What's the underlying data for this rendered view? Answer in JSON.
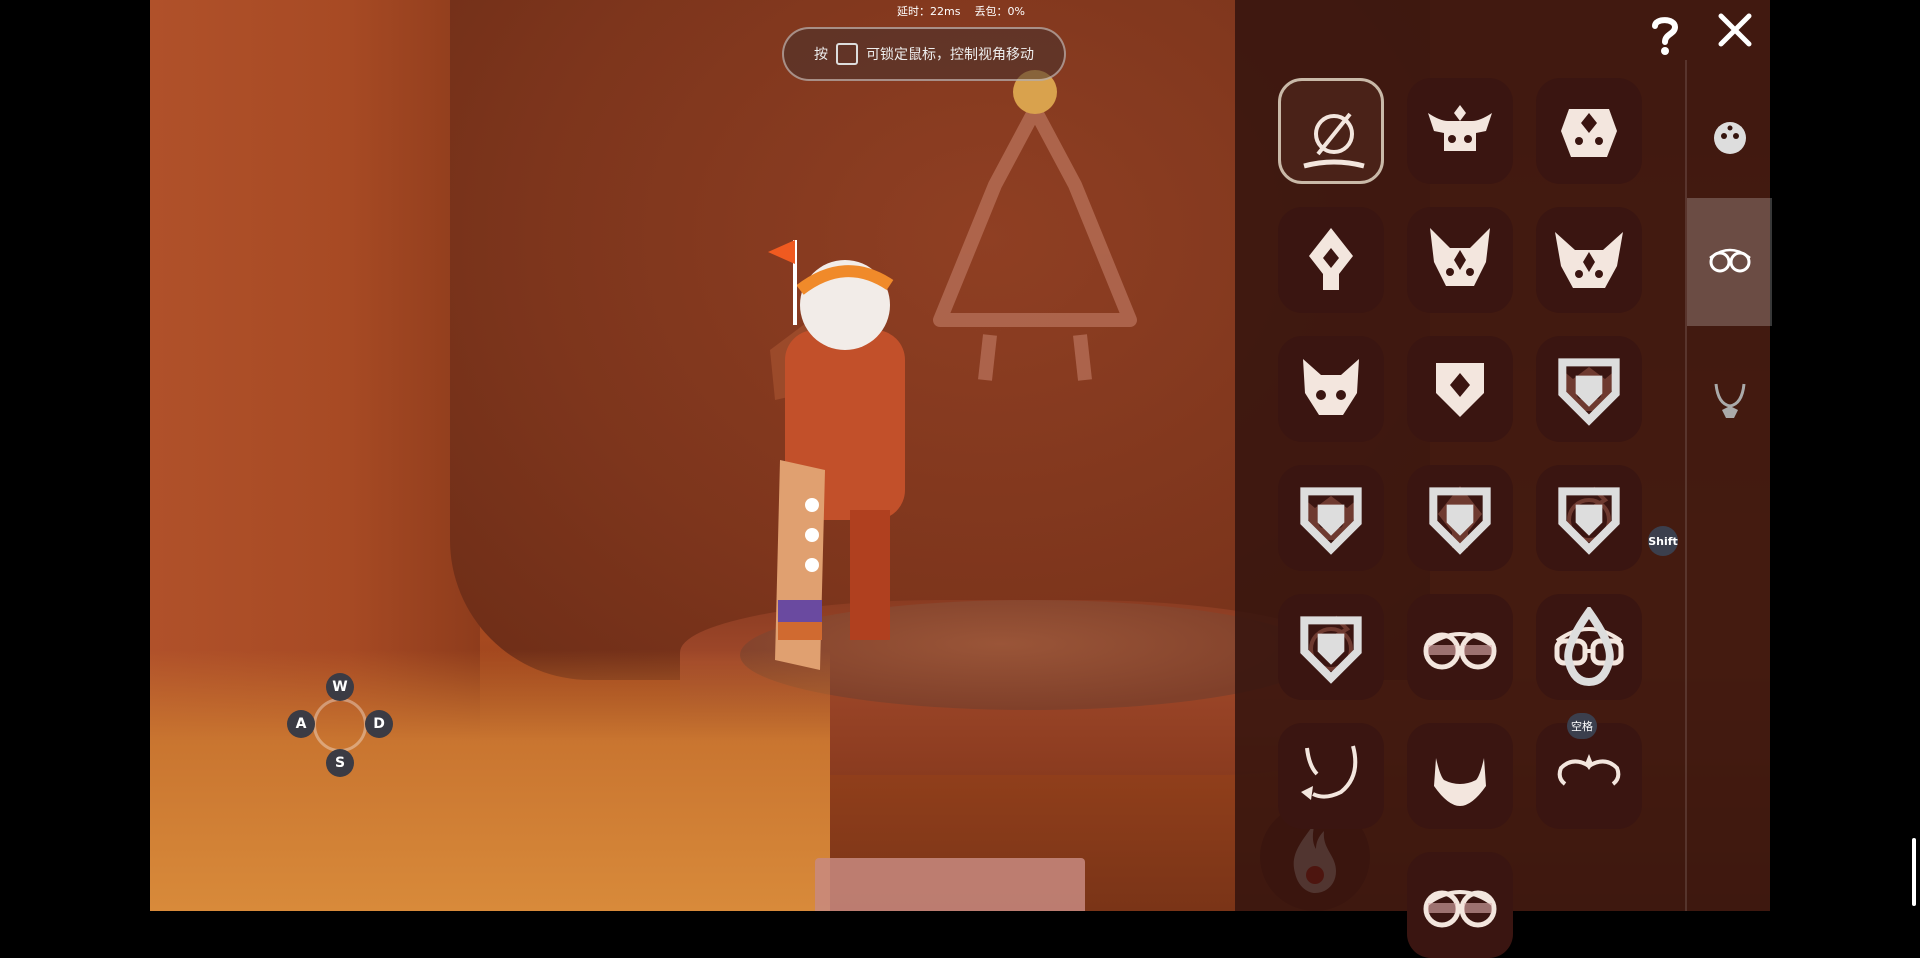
{
  "hud": {
    "latency": "延时：22ms",
    "packet_loss": "丢包：0%",
    "hint_prefix": "按",
    "hint_suffix": "可锁定鼠标，控制视角移动"
  },
  "movement_keys": {
    "up": "W",
    "left": "A",
    "down": "S",
    "right": "D"
  },
  "wardrobe": {
    "grid": [
      [
        {
          "icon": "none-icon",
          "selected": true
        },
        {
          "icon": "horned-mask-icon"
        },
        {
          "icon": "diamond-mask-icon"
        }
      ],
      [
        {
          "icon": "spade-mask-icon"
        },
        {
          "icon": "fox-mask-icon"
        },
        {
          "icon": "horned-fox-mask-icon"
        }
      ],
      [
        {
          "icon": "cat-mask-icon"
        },
        {
          "icon": "shield-mask-icon"
        },
        {
          "icon": "crown-mask-icon",
          "locked": true
        }
      ],
      [
        {
          "icon": "crown-mask-icon",
          "locked": true
        },
        {
          "icon": "spade-mask-icon",
          "locked": true
        },
        {
          "icon": "swirl-mask-icon",
          "locked": true
        }
      ],
      [
        {
          "icon": "swirl-mask-icon",
          "locked": true
        },
        {
          "icon": "round-glasses-icon"
        },
        {
          "icon": "square-glasses-icon",
          "candle_cost": true
        }
      ],
      [
        {
          "icon": "tail-mustache-icon"
        },
        {
          "icon": "beard-icon"
        },
        {
          "icon": "curled-mustache-icon"
        }
      ],
      [
        {
          "icon": null
        },
        {
          "icon": "round-glasses-icon"
        },
        {
          "icon": null
        }
      ]
    ],
    "badge_label": "空格",
    "shift_label": "Shift",
    "tabs": [
      {
        "icon": "mask-face-icon"
      },
      {
        "icon": "glasses-icon",
        "active": true
      },
      {
        "icon": "necklace-icon"
      }
    ]
  },
  "colors": {
    "panel": "#34140e",
    "tile": "#3a1511",
    "icon": "#f3e6de",
    "icon_dim": "#6e3a30",
    "badge": "#3b3f4d"
  }
}
